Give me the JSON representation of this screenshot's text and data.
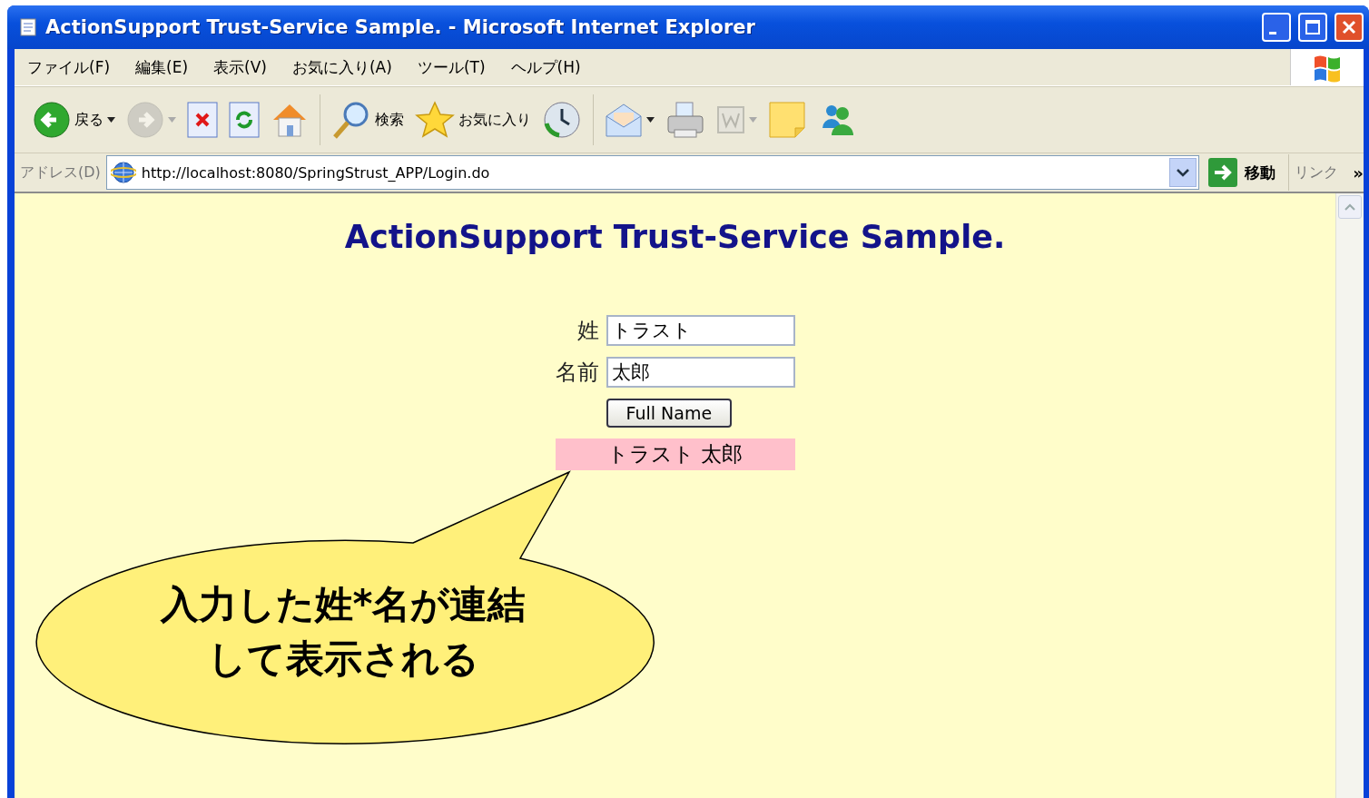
{
  "window": {
    "title": "ActionSupport Trust-Service Sample. - Microsoft Internet Explorer"
  },
  "menu": [
    "ファイル(F)",
    "編集(E)",
    "表示(V)",
    "お気に入り(A)",
    "ツール(T)",
    "ヘルプ(H)"
  ],
  "toolbar": {
    "groups": [
      [
        {
          "kind": "back",
          "label": "戻る",
          "menu": true,
          "disabled": false
        },
        {
          "kind": "forward",
          "menu": true,
          "disabled": true
        },
        {
          "kind": "stop",
          "menu": false
        },
        {
          "kind": "refresh",
          "menu": false
        },
        {
          "kind": "home",
          "menu": false
        }
      ],
      [
        {
          "kind": "search",
          "label": "検索",
          "menu": false
        },
        {
          "kind": "favorites",
          "label": "お気に入り",
          "menu": false
        },
        {
          "kind": "history",
          "menu": false
        }
      ],
      [
        {
          "kind": "mail",
          "menu": true,
          "disabled": false
        },
        {
          "kind": "print",
          "menu": false
        },
        {
          "kind": "edit",
          "menu": true,
          "disabled": true
        },
        {
          "kind": "note",
          "menu": false
        },
        {
          "kind": "messenger",
          "menu": false
        }
      ]
    ]
  },
  "address": {
    "label": "アドレス(D)",
    "url": "http://localhost:8080/SpringStrust_APP/Login.do",
    "go": "移動",
    "links": "リンク",
    "more": "»"
  },
  "page": {
    "heading": "ActionSupport Trust-Service Sample.",
    "fields": [
      {
        "label": "姓",
        "value": "トラスト"
      },
      {
        "label": "名前",
        "value": "太郎"
      }
    ],
    "button": "Full Name",
    "result": "トラスト 太郎"
  },
  "callout": {
    "lines": [
      "入力した姓*名が連結",
      "して表示される"
    ]
  }
}
